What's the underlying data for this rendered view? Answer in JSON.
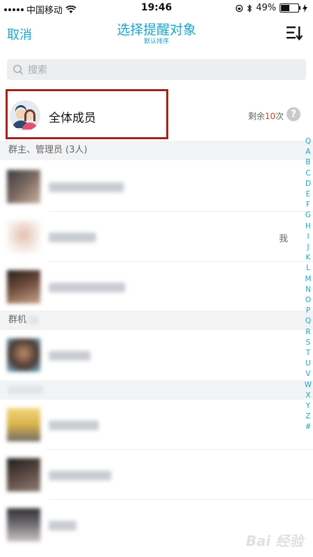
{
  "status_bar": {
    "carrier": "中国移动",
    "time": "19:46",
    "battery_percent": "49%",
    "battery_level": 0.49
  },
  "navbar": {
    "cancel_label": "取消",
    "title": "选择提醒对象",
    "subtitle": "默认排序",
    "sort_icon": "sort-icon"
  },
  "search": {
    "placeholder": "搜索"
  },
  "all_members": {
    "label": "全体成员",
    "remain_prefix": "剩余",
    "remain_count": "10",
    "remain_suffix": "次",
    "help_label": "?"
  },
  "sections": [
    {
      "title": "群主、管理员 (3人)"
    },
    {
      "title": "群机"
    }
  ],
  "members": [
    {
      "me_tag": ""
    },
    {
      "me_tag": "我"
    },
    {
      "me_tag": ""
    },
    {
      "me_tag": ""
    },
    {
      "me_tag": ""
    },
    {
      "me_tag": ""
    },
    {
      "me_tag": ""
    }
  ],
  "alphabet_index": [
    "Q",
    "A",
    "B",
    "C",
    "D",
    "E",
    "F",
    "G",
    "H",
    "I",
    "J",
    "K",
    "L",
    "M",
    "N",
    "O",
    "P",
    "Q",
    "R",
    "S",
    "T",
    "U",
    "V",
    "W",
    "X",
    "Y",
    "Z",
    "#"
  ],
  "colors": {
    "accent": "#1aa4c8",
    "highlight_border": "#a3211b",
    "count_red": "#d0382f"
  },
  "watermark": "Bai 经验"
}
